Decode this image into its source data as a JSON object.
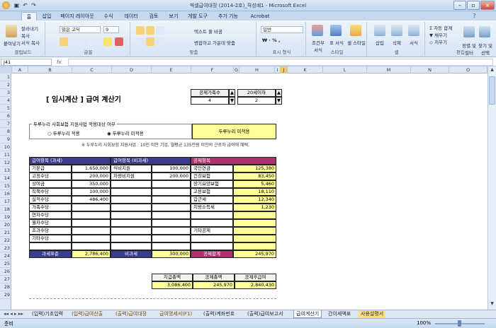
{
  "window": {
    "title": "엑셀급여대장 (2014-2호)_작성예1 - Microsoft Excel"
  },
  "tabs": [
    "홈",
    "삽입",
    "페이지 레이아웃",
    "수식",
    "데이터",
    "검토",
    "보기",
    "개발 도구",
    "추가 기능",
    "Acrobat"
  ],
  "ribbon": {
    "clipboard": {
      "name": "클립보드",
      "paste": "붙여넣기",
      "cut": "잘라내기",
      "copy": "복사",
      "format_painter": "서식 복사"
    },
    "font": {
      "name": "글꼴",
      "font_family": "맑은 고딕",
      "font_size": "9"
    },
    "alignment": {
      "name": "맞춤",
      "wrap": "텍스트 줄 바꿈",
      "merge": "병합하고 가운데 맞춤"
    },
    "number": {
      "name": "표시 형식",
      "format": "일반"
    },
    "styles": {
      "name": "스타일",
      "conditional": "조건부 서식",
      "table": "표 서식",
      "cell": "셀 스타일"
    },
    "cells": {
      "name": "셀",
      "insert": "삽입",
      "delete": "삭제",
      "format": "서식"
    },
    "editing": {
      "name": "편집",
      "autosum": "자동 합계",
      "fill": "채우기",
      "clear": "지우기",
      "sort": "정렬 및 필터",
      "find": "찾기 및 선택"
    }
  },
  "formula_bar": {
    "namebox": "J41",
    "fx": "fx",
    "value": ""
  },
  "columns": [
    "A",
    "B",
    "C",
    "D",
    "E",
    "F",
    "G",
    "H",
    "I",
    "J",
    "K",
    "L",
    "M",
    "N",
    "O"
  ],
  "rows": [
    "1",
    "2",
    "3",
    "4",
    "5",
    "6",
    "7",
    "8",
    "9",
    "10",
    "11",
    "12",
    "13",
    "14",
    "15",
    "16",
    "17",
    "18",
    "19",
    "20",
    "21",
    "22",
    "23",
    "24",
    "25",
    "26",
    "27",
    "28",
    "29"
  ],
  "sheet": {
    "title": "[ 임시계산 ]  급여 계산기",
    "spin1": {
      "label": "공제가족수",
      "value": "4"
    },
    "spin2": {
      "label": "20세이하",
      "value": "2"
    },
    "duru": {
      "legend": "두루누리 사회보험 지원사업 적용대상 여부",
      "opt1": "두루누리 적용",
      "opt2": "두루누리 미적용",
      "status": "두루누리 미적용",
      "note": "※ 두루누리 사회보험 지원사업 : 10인 미만 기업, 월평균 135만원 미만의 근로자 급여에 혜택."
    },
    "taxable": {
      "header": "급여항목 (과세)",
      "items": [
        {
          "label": "기본급",
          "value": "1,650,000"
        },
        {
          "label": "고정수당",
          "value": "200,000"
        },
        {
          "label": "상여금",
          "value": "350,000"
        },
        {
          "label": "직책수당",
          "value": "100,000"
        },
        {
          "label": "실적수당",
          "value": "486,400"
        },
        {
          "label": "가족수당",
          "value": ""
        },
        {
          "label": "연차수당",
          "value": ""
        },
        {
          "label": "월차수당",
          "value": ""
        },
        {
          "label": "초과수당",
          "value": ""
        },
        {
          "label": "기타수당",
          "value": ""
        },
        {
          "label": "",
          "value": ""
        }
      ],
      "total_label": "과세표준",
      "total_value": "2,786,400"
    },
    "nontaxable": {
      "header": "급여항목 (비과세)",
      "items": [
        {
          "label": "식비지원",
          "value": "100,000"
        },
        {
          "label": "차량비지원",
          "value": "200,000"
        }
      ],
      "total_label": "비과세",
      "total_value": "300,000"
    },
    "deduction": {
      "header": "공제항목",
      "items": [
        {
          "label": "국민연금",
          "value": "125,380"
        },
        {
          "label": "건강보험",
          "value": "83,450"
        },
        {
          "label": "장기요양보험",
          "value": "5,460"
        },
        {
          "label": "고용보험",
          "value": "18,110"
        },
        {
          "label": "갑근세",
          "value": "12,340"
        },
        {
          "label": "지방소득세",
          "value": "1,230"
        },
        {
          "label": "",
          "value": ""
        },
        {
          "label": "",
          "value": ""
        },
        {
          "label": "기타공제",
          "value": ""
        },
        {
          "label": "",
          "value": ""
        },
        {
          "label": "",
          "value": ""
        }
      ],
      "total_label": "공제합계",
      "total_value": "245,970"
    },
    "summary": {
      "labels": [
        "지급총액",
        "공제총액",
        "공제후급여"
      ],
      "values": [
        "3,086,400",
        "245,970",
        "2,840,430"
      ]
    }
  },
  "sheet_tabs": [
    "(입력)기초입력",
    "(입력)급여산출",
    "(출력)급여대장",
    "급여명세서(F1)",
    "(출력)계좌번호",
    "(출력)급여보고서",
    "급여계산기",
    "간이세액표",
    "사용설명서"
  ],
  "status": {
    "text": "준비",
    "zoom": "100%"
  },
  "colors": {
    "header_blue": "#3c3c8e",
    "header_pink": "#b0306c",
    "highlight": "#ffff99"
  }
}
